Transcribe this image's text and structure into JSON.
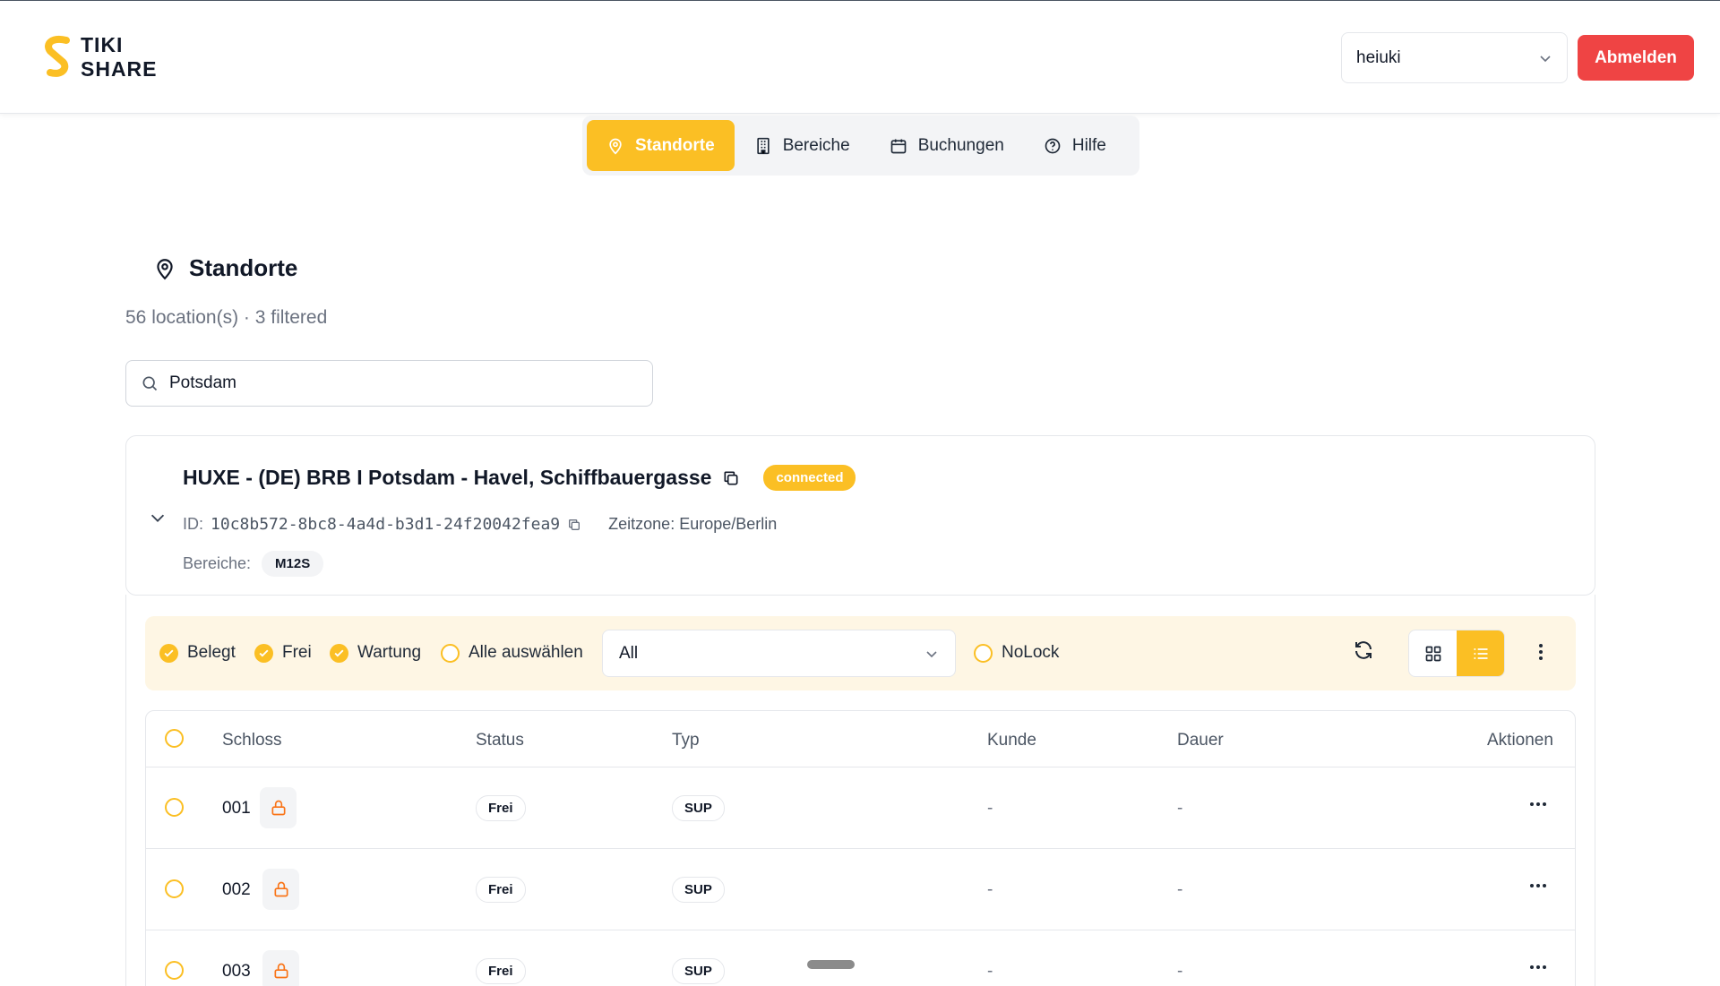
{
  "app": {
    "logo_line1": "TIKI",
    "logo_line2": "SHARE",
    "brand_color": "#fbbf24",
    "danger_color": "#ef4444"
  },
  "header": {
    "user_select_value": "heiuki",
    "logout_label": "Abmelden"
  },
  "nav": {
    "items": [
      {
        "label": "Standorte",
        "icon": "map-pin-icon",
        "active": true
      },
      {
        "label": "Bereiche",
        "icon": "building-icon",
        "active": false
      },
      {
        "label": "Buchungen",
        "icon": "calendar-icon",
        "active": false
      },
      {
        "label": "Hilfe",
        "icon": "help-circle-icon",
        "active": false
      }
    ]
  },
  "page": {
    "title": "Standorte",
    "subtitle": "56 location(s) · 3 filtered",
    "search_value": "Potsdam"
  },
  "location": {
    "name": "HUXE - (DE) BRB I Potsdam - Havel, Schiffbauergasse",
    "status": "connected",
    "id_label": "ID:",
    "id_value": "10c8b572-8bc8-4a4d-b3d1-24f20042fea9",
    "timezone": "Zeitzone: Europe/Berlin",
    "areas_label": "Bereiche:",
    "areas": [
      "M12S"
    ]
  },
  "filters": {
    "belegt": {
      "label": "Belegt",
      "checked": true
    },
    "frei": {
      "label": "Frei",
      "checked": true
    },
    "wartung": {
      "label": "Wartung",
      "checked": true
    },
    "select_all": {
      "label": "Alle auswählen",
      "checked": false
    },
    "type_select_value": "All",
    "nolock": {
      "label": "NoLock",
      "checked": false
    },
    "view_mode": "list"
  },
  "table": {
    "columns": [
      "Schloss",
      "Status",
      "Typ",
      "Kunde",
      "Dauer",
      "Aktionen"
    ],
    "rows": [
      {
        "schloss": "001",
        "status": "Frei",
        "typ": "SUP",
        "kunde": "-",
        "dauer": "-"
      },
      {
        "schloss": "002",
        "status": "Frei",
        "typ": "SUP",
        "kunde": "-",
        "dauer": "-"
      },
      {
        "schloss": "003",
        "status": "Frei",
        "typ": "SUP",
        "kunde": "-",
        "dauer": "-"
      }
    ]
  }
}
